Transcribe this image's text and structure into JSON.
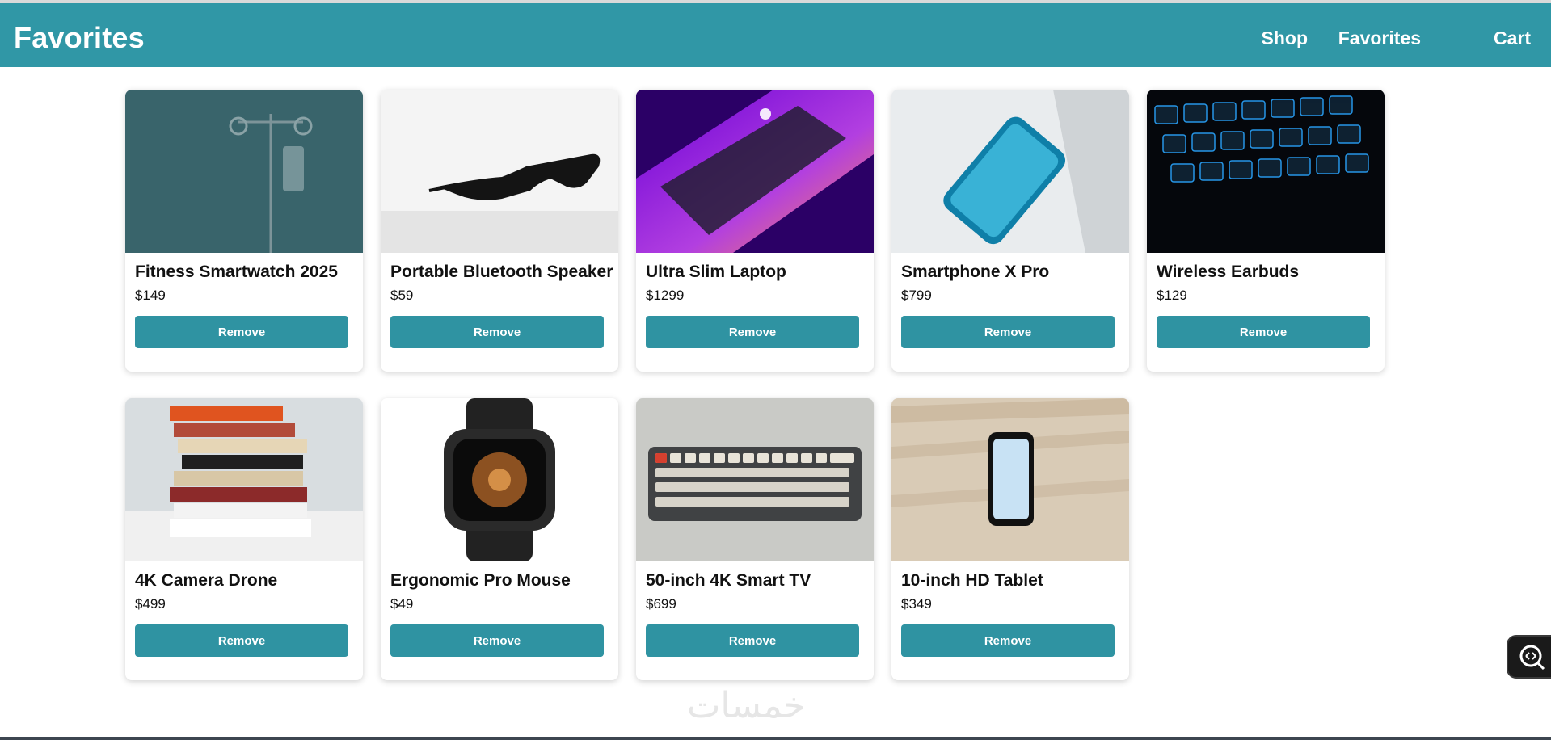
{
  "header": {
    "title": "Favorites",
    "nav": [
      {
        "label": "Shop"
      },
      {
        "label": "Favorites"
      },
      {
        "label": "Cart"
      }
    ]
  },
  "products": [
    {
      "name": "Fitness Smartwatch 2025",
      "price": "$149",
      "button": "Remove",
      "image": "iv-stand-photo"
    },
    {
      "name": "Portable Bluetooth Speaker",
      "price": "$59",
      "button": "Remove",
      "image": "sunglasses-photo"
    },
    {
      "name": "Ultra Slim Laptop",
      "price": "$1299",
      "button": "Remove",
      "image": "laptop-photo"
    },
    {
      "name": "Smartphone X Pro",
      "price": "$799",
      "button": "Remove",
      "image": "smartphone-photo"
    },
    {
      "name": "Wireless Earbuds",
      "price": "$129",
      "button": "Remove",
      "image": "keyboard-backlit-photo"
    },
    {
      "name": "4K Camera Drone",
      "price": "$499",
      "button": "Remove",
      "image": "book-stack-photo"
    },
    {
      "name": "Ergonomic Pro Mouse",
      "price": "$49",
      "button": "Remove",
      "image": "smartwatch-photo"
    },
    {
      "name": "50-inch 4K Smart TV",
      "price": "$699",
      "button": "Remove",
      "image": "mechanical-keyboard-photo"
    },
    {
      "name": "10-inch HD Tablet",
      "price": "$349",
      "button": "Remove",
      "image": "phone-on-wood-photo"
    }
  ],
  "watermark": {
    "text": "خمسات"
  },
  "colors": {
    "primary": "#3097a6",
    "button": "#2f93a2",
    "text": "#111111"
  },
  "icons": {
    "floating_button": "code-search-icon"
  }
}
